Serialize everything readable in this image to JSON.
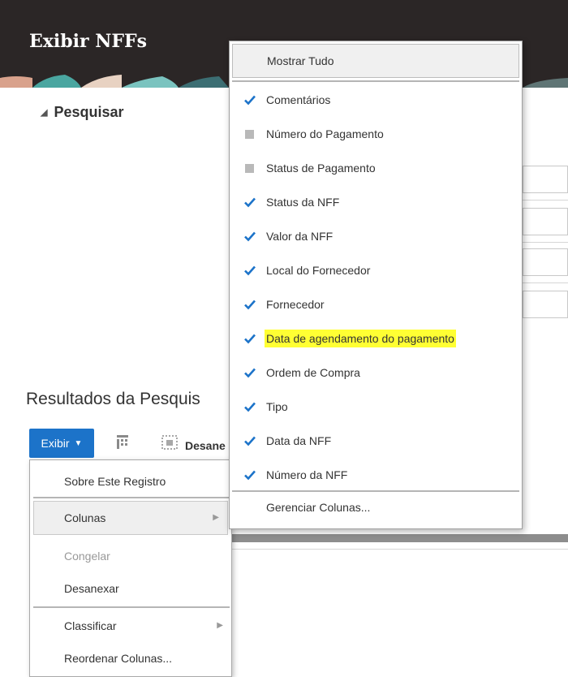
{
  "header": {
    "title": "Exibir NFFs"
  },
  "search": {
    "label": "Pesquisar"
  },
  "results": {
    "title": "Resultados da Pesquis"
  },
  "toolbar": {
    "view_label": "Exibir",
    "detach_label": "Desane"
  },
  "view_menu": {
    "items": [
      {
        "label": "Sobre Este Registro"
      },
      {
        "label": "Colunas",
        "highlighted": true,
        "submenu": true
      },
      {
        "label": "Congelar",
        "disabled": true
      },
      {
        "label": "Desanexar"
      },
      {
        "label": "Classificar",
        "submenu": true
      },
      {
        "label": "Reordenar Colunas..."
      }
    ]
  },
  "columns_menu": {
    "show_all": "Mostrar Tudo",
    "items": [
      {
        "label": "Comentários",
        "checked": true
      },
      {
        "label": "Número do Pagamento",
        "checked": false
      },
      {
        "label": "Status de Pagamento",
        "checked": false
      },
      {
        "label": "Status da NFF",
        "checked": true
      },
      {
        "label": "Valor da NFF",
        "checked": true
      },
      {
        "label": "Local do Fornecedor",
        "checked": true
      },
      {
        "label": "Fornecedor",
        "checked": true
      },
      {
        "label": "Data de agendamento do pagamento",
        "checked": true,
        "highlighted": true
      },
      {
        "label": "Ordem de Compra",
        "checked": true
      },
      {
        "label": "Tipo",
        "checked": true
      },
      {
        "label": "Data da NFF",
        "checked": true
      },
      {
        "label": "Número da NFF",
        "checked": true
      }
    ],
    "manage": "Gerenciar Colunas..."
  },
  "colors": {
    "header_bg": "#2b2626",
    "accent_blue": "#1c73c9",
    "highlight_yellow": "#ffff33"
  }
}
